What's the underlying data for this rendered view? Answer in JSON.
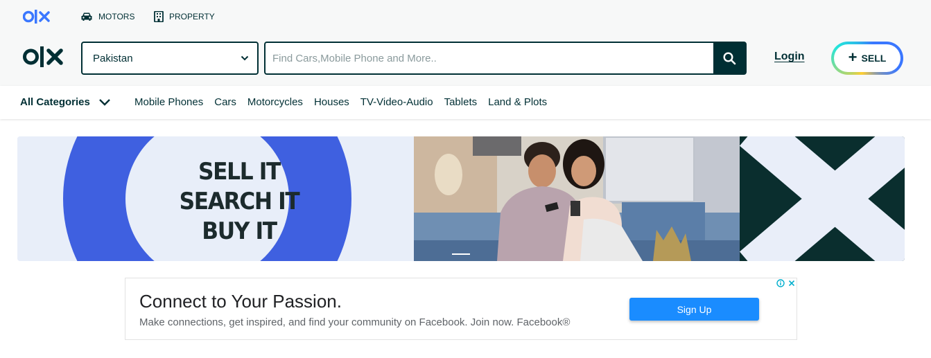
{
  "header": {
    "top_links": {
      "motors": "MOTORS",
      "property": "PROPERTY"
    },
    "location": {
      "value": "Pakistan"
    },
    "search": {
      "placeholder": "Find Cars,Mobile Phone and More.."
    },
    "login_label": "Login",
    "sell_label": "SELL",
    "sell_plus": "+"
  },
  "categories": {
    "all_label": "All Categories",
    "items": [
      "Mobile Phones",
      "Cars",
      "Motorcycles",
      "Houses",
      "TV-Video-Audio",
      "Tablets",
      "Land & Plots"
    ]
  },
  "banner": {
    "lines": [
      "SELL IT",
      "SEARCH IT",
      "BUY IT"
    ]
  },
  "ad": {
    "title": "Connect to Your Passion.",
    "description": "Make connections, get inspired, and find your community on Facebook. Join now. Facebook®",
    "button_label": "Sign Up"
  },
  "colors": {
    "brand_dark": "#002f34",
    "brand_blue": "#3a77ff",
    "banner_ring": "#3f60e0",
    "banner_dark": "#0a2e2e",
    "ad_button": "#1a8cff"
  },
  "icons": {
    "car": "car-icon",
    "building": "building-icon",
    "search": "search-icon",
    "chevron": "chevron-down-icon",
    "ad_info": "info-icon",
    "ad_close": "close-icon"
  }
}
